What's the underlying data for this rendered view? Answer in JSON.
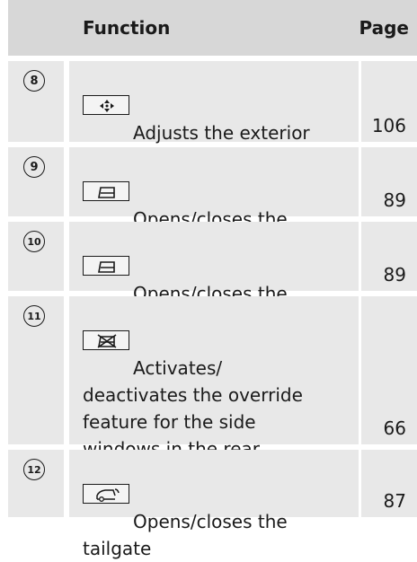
{
  "header": {
    "function": "Function",
    "page": "Page"
  },
  "rows": [
    {
      "num": "8",
      "icon": "mirror-adjust-icon",
      "text": "Adjusts the exterior\nmirrors",
      "page": "106"
    },
    {
      "num": "9",
      "icon": "window-icon",
      "text": "Opens/closes the\nfront side windows",
      "page": "89"
    },
    {
      "num": "10",
      "icon": "window-icon",
      "text": "Opens/closes the\nrear side windows",
      "page": "89"
    },
    {
      "num": "11",
      "icon": "window-lock-icon",
      "text": "Activates/\ndeactivates the override\nfeature for the side\nwindows in the rear\ncompartment",
      "page": "66"
    },
    {
      "num": "12",
      "icon": "tailgate-icon",
      "text": "Opens/closes the\ntailgate",
      "page": "87"
    }
  ]
}
